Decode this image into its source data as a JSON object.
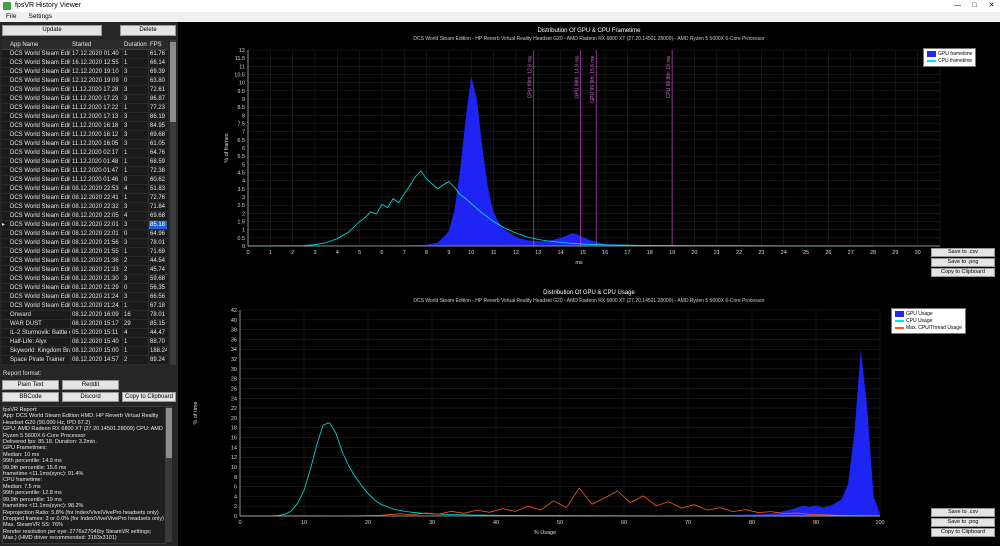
{
  "window": {
    "title": "fpsVR History Viewer",
    "menu": [
      "File",
      "Settings"
    ],
    "controls": {
      "minimize": "—",
      "maximize": "□",
      "close": "✕"
    }
  },
  "left_panel": {
    "update_button": "Update",
    "delete_button": "Delete",
    "table": {
      "columns": [
        "App Name",
        "Started",
        "Duration",
        "FPS"
      ],
      "selected_index": 19,
      "rows": [
        [
          "DCS World Steam Edition",
          "17.12.2020 01:40",
          "1",
          "61.76"
        ],
        [
          "DCS World Steam Edition",
          "16.12.2020 12:55",
          "1",
          "66.14"
        ],
        [
          "DCS World Steam Edition",
          "12.12.2020 19:10",
          "3",
          "69.39"
        ],
        [
          "DCS World Steam Edition",
          "12.12.2020 19:09",
          "0",
          "63.80"
        ],
        [
          "DCS World Steam Edition",
          "11.12.2020 17:28",
          "3",
          "72.61"
        ],
        [
          "DCS World Steam Edition",
          "11.12.2020 17:23",
          "3",
          "86.87"
        ],
        [
          "DCS World Steam Edition",
          "11.12.2020 17:22",
          "1",
          "77.23"
        ],
        [
          "DCS World Steam Edition",
          "11.12.2020 17:13",
          "3",
          "86.19"
        ],
        [
          "DCS World Steam Edition",
          "11.12.2020 16:18",
          "3",
          "84.95"
        ],
        [
          "DCS World Steam Edition",
          "11.12.2020 16:12",
          "3",
          "69.68"
        ],
        [
          "DCS World Steam Edition",
          "11.12.2020 16:05",
          "3",
          "61.05"
        ],
        [
          "DCS World Steam Edition",
          "11.12.2020 02:17",
          "1",
          "64.76"
        ],
        [
          "DCS World Steam Edition",
          "11.12.2020 01:48",
          "1",
          "68.59"
        ],
        [
          "DCS World Steam Edition",
          "11.12.2020 01:47",
          "1",
          "72.38"
        ],
        [
          "DCS World Steam Edition",
          "11.12.2020 01:46",
          "0",
          "60.62"
        ],
        [
          "DCS World Steam Edition",
          "08.12.2020 22:53",
          "4",
          "51.83"
        ],
        [
          "DCS World Steam Edition",
          "08.12.2020 22:41",
          "1",
          "72.76"
        ],
        [
          "DCS World Steam Edition",
          "08.12.2020 22:32",
          "3",
          "71.84"
        ],
        [
          "DCS World Steam Edition",
          "08.12.2020 22:05",
          "4",
          "69.68"
        ],
        [
          "DCS World Steam Edition",
          "08.12.2020 22:01",
          "3",
          "85.18"
        ],
        [
          "DCS World Steam Edition",
          "08.12.2020 22:01",
          "0",
          "64.96"
        ],
        [
          "DCS World Steam Edition",
          "08.12.2020 21:56",
          "3",
          "78.01"
        ],
        [
          "DCS World Steam Edition",
          "08.12.2020 21:55",
          "1",
          "71.69"
        ],
        [
          "DCS World Steam Edition",
          "08.12.2020 21:36",
          "2",
          "44.54"
        ],
        [
          "DCS World Steam Edition",
          "08.12.2020 21:33",
          "2",
          "45.74"
        ],
        [
          "DCS World Steam Edition",
          "08.12.2020 21:30",
          "3",
          "59.68"
        ],
        [
          "DCS World Steam Edition",
          "08.12.2020 21:29",
          "0",
          "56.35"
        ],
        [
          "DCS World Steam Edition",
          "08.12.2020 21:24",
          "3",
          "66.56"
        ],
        [
          "DCS World Steam Edition",
          "08.12.2020 21:24",
          "1",
          "67.18"
        ],
        [
          "Onward",
          "08.12.2020 16:09",
          "16",
          "78.01"
        ],
        [
          "WAR DUST",
          "08.12.2020 15:17",
          "29",
          "85.15"
        ],
        [
          "IL-2 Sturmovik: Battle of Sta...",
          "05.12.2020 15:11",
          "4",
          "44.47"
        ],
        [
          "Half-Life: Alyx",
          "08.12.2020 15:40",
          "1",
          "88.70"
        ],
        [
          "Skyworld: Kingdom Brawl",
          "08.12.2020 15:00",
          "1",
          "188.24"
        ],
        [
          "Space Pirate Trainer",
          "08.12.2020 14:57",
          "2",
          "89.24"
        ]
      ]
    },
    "report_format": {
      "label": "Report format:",
      "buttons": [
        "Plain Text",
        "Reddit",
        "BBCode",
        "Discord"
      ],
      "copy_button": "Copy to Clipboard"
    },
    "report_text": "fpsVR Report:\nApp: DCS World Steam Edition HMD: HP Reverb Virtual Reality Headset G20 (90.000 Hz, IPD 67.2)\nGPU: AMD Radeon RX 6800 XT (27.20.14501.28009) CPU: AMD Ryzen 5 5600X 6-Core Processor\nDelivered fps: 85.18. Duration: 3.2min.\nGPU Frametimes:\nMedian: 10 ms\n99th percentile: 14.9 ms\n99.9th percentile: 15.6 ms\nframetime <11.1ms(sync): 91.4%\nCPU frametime:\nMedian: 7.5 ms\n99th percentile: 12.8 ms\n99.9th percentile: 19 ms\nframetime <11.1ms(sync): 98.2%\nReprojection Ratio: 5.8% (for Index/Vive/VivePro headsets only)\nDropped frames: 3 or 0.0% (for Index/Vive/VivePro headsets only)\nMax. SteamVR SS: 76%\nRender resolution per eye: 2776x2704(by SteamVR settings; Max.) (HMD driver recommended: 3183x3101)"
  },
  "chart_buttons": [
    "Save to .csv",
    "Save to .png",
    "Copy to Clipboard"
  ],
  "colors": {
    "gpu_blue": "#2026ff",
    "cpu_cyan": "#00e5e5",
    "max_thread_orange": "#ff5714",
    "marker_magenta": "#c04ac0",
    "selection_blue": "#2160d4"
  },
  "charts": [
    {
      "type": "area",
      "title": "Distribution Of GPU & CPU Frametime",
      "subtitle": "DCS World Steam Edition - HP Reverb Virtual Reality Headset G20 - AMD Radeon RX 6800 XT (27.20.14501.28009) - AMD Ryzen 5 5600X 6-Core Processor",
      "xlabel": "ms",
      "ylabel": "% of frames",
      "xlim": [
        0,
        31
      ],
      "xstep": 1,
      "ylim": [
        0,
        12
      ],
      "ystep": 0.5,
      "legend_position": "top-right",
      "grid": true,
      "series": [
        {
          "name": "GPU frametime",
          "color": "#2026ff",
          "fill": true,
          "x": [
            0,
            6,
            7,
            8,
            8.5,
            9,
            9.25,
            9.5,
            9.75,
            10,
            10.25,
            10.5,
            10.75,
            11,
            11.25,
            11.5,
            12,
            12.5,
            13,
            13.5,
            14,
            14.25,
            14.5,
            14.75,
            15,
            15.25,
            15.5,
            16,
            17,
            18,
            19,
            20,
            21,
            22,
            23,
            24,
            25,
            26,
            27,
            28,
            29,
            30,
            31
          ],
          "y": [
            0,
            0.02,
            0.04,
            0.08,
            0.2,
            0.9,
            2.2,
            4.6,
            7.8,
            10.4,
            9.0,
            6.0,
            3.6,
            2.1,
            1.4,
            1.0,
            0.55,
            0.35,
            0.28,
            0.32,
            0.5,
            0.62,
            0.78,
            0.72,
            0.55,
            0.4,
            0.28,
            0.12,
            0.07,
            0.05,
            0.05,
            0.04,
            0.03,
            0.03,
            0.03,
            0.02,
            0.02,
            0.02,
            0.02,
            0.02,
            0.02,
            0.02,
            0.02
          ]
        },
        {
          "name": "CPU frametime",
          "color": "#00e5e5",
          "fill": false,
          "x": [
            0,
            2.5,
            3,
            3.5,
            4,
            4.5,
            5,
            5.25,
            5.5,
            5.75,
            6,
            6.25,
            6.5,
            6.75,
            7,
            7.25,
            7.5,
            7.75,
            8,
            8.25,
            8.5,
            8.75,
            9,
            9.25,
            9.5,
            9.75,
            10,
            10.5,
            11,
            11.5,
            12,
            12.5,
            13,
            13.5,
            14,
            14.5,
            15,
            16,
            17,
            18,
            19,
            20,
            22,
            24,
            26,
            28,
            31
          ],
          "y": [
            0,
            0.02,
            0.08,
            0.2,
            0.45,
            0.85,
            1.5,
            1.75,
            2.1,
            1.95,
            2.55,
            2.35,
            2.9,
            2.65,
            3.2,
            3.7,
            4.25,
            4.6,
            4.1,
            3.8,
            3.5,
            3.75,
            3.95,
            3.6,
            3.15,
            2.9,
            2.6,
            2.0,
            1.5,
            1.1,
            0.8,
            0.55,
            0.4,
            0.3,
            0.22,
            0.16,
            0.12,
            0.07,
            0.05,
            0.04,
            0.03,
            0.02,
            0.02,
            0.01,
            0.01,
            0
          ]
        }
      ],
      "markers": [
        {
          "label": "CPU 99th: 12.8 ms",
          "x": 12.8
        },
        {
          "label": "GPU 99th: 14.9 ms",
          "x": 14.9
        },
        {
          "label": "GPU 99.9th: 15.6 ms",
          "x": 15.6
        },
        {
          "label": "CPU 99.9th: 19 ms",
          "x": 19
        }
      ]
    },
    {
      "type": "area",
      "title": "Distribution Of GPU & CPU Usage",
      "subtitle": "DCS World Steam Edition - HP Reverb Virtual Reality Headset G20 - AMD Radeon RX 6800 XT (27.20.14501.28009) - AMD Ryzen 5 5600X 6-Core Processor",
      "xlabel": "% Usage",
      "ylabel": "% of time",
      "xlim": [
        0,
        100
      ],
      "xstep": 10,
      "ylim": [
        0,
        42
      ],
      "ystep": 2,
      "legend_position": "top-right",
      "grid": true,
      "series": [
        {
          "name": "GPU Usage",
          "color": "#2026ff",
          "fill": true,
          "x": [
            0,
            5,
            10,
            15,
            20,
            25,
            30,
            35,
            40,
            45,
            50,
            55,
            60,
            65,
            70,
            75,
            80,
            82,
            84,
            86,
            88,
            89,
            90,
            91,
            92,
            93,
            94,
            95,
            96,
            97,
            98,
            99,
            100
          ],
          "y": [
            0,
            0.1,
            0.15,
            0.1,
            0.12,
            0.1,
            0.12,
            0.1,
            0.12,
            0.1,
            0.15,
            0.12,
            0.15,
            0.12,
            0.15,
            0.2,
            0.3,
            0.4,
            0.7,
            1.3,
            2.1,
            1.8,
            2.2,
            1.7,
            2.0,
            2.6,
            3.4,
            6.5,
            17,
            34,
            22,
            4,
            0.4
          ]
        },
        {
          "name": "CPU Usage",
          "color": "#00e5e5",
          "fill": false,
          "x": [
            0,
            5,
            6,
            7,
            8,
            9,
            10,
            11,
            12,
            13,
            14,
            15,
            16,
            17,
            18,
            19,
            20,
            21,
            22,
            24,
            26,
            28,
            30,
            33,
            36,
            40,
            45,
            50,
            60,
            70,
            100
          ],
          "y": [
            0,
            0.05,
            0.1,
            0.35,
            1.0,
            2.6,
            5.2,
            9.5,
            14.5,
            18.6,
            19.0,
            16.8,
            13.0,
            10.2,
            8.0,
            6.2,
            4.6,
            3.3,
            2.4,
            1.4,
            0.9,
            0.6,
            0.45,
            0.3,
            0.2,
            0.15,
            0.1,
            0.06,
            0.03,
            0.02,
            0
          ]
        },
        {
          "name": "Max. CPU/Thread Usage",
          "color": "#ff5714",
          "fill": false,
          "x": [
            0,
            18,
            22,
            25,
            27,
            29,
            31,
            33,
            35,
            37,
            39,
            41,
            43,
            45,
            47,
            49,
            51,
            53,
            55,
            57,
            59,
            61,
            63,
            65,
            67,
            69,
            71,
            73,
            75,
            77,
            79,
            81,
            83,
            85,
            87,
            89,
            91,
            94,
            100
          ],
          "y": [
            0,
            0.03,
            0.15,
            0.45,
            0.25,
            0.6,
            0.35,
            0.95,
            0.55,
            1.2,
            0.75,
            1.5,
            0.95,
            2.0,
            1.2,
            3.1,
            1.7,
            5.7,
            2.4,
            3.7,
            5.1,
            2.7,
            4.1,
            2.1,
            2.9,
            1.6,
            2.3,
            1.2,
            1.7,
            0.9,
            1.3,
            0.7,
            0.9,
            0.5,
            0.6,
            0.35,
            0.25,
            0.12,
            0
          ]
        }
      ],
      "markers": []
    }
  ]
}
